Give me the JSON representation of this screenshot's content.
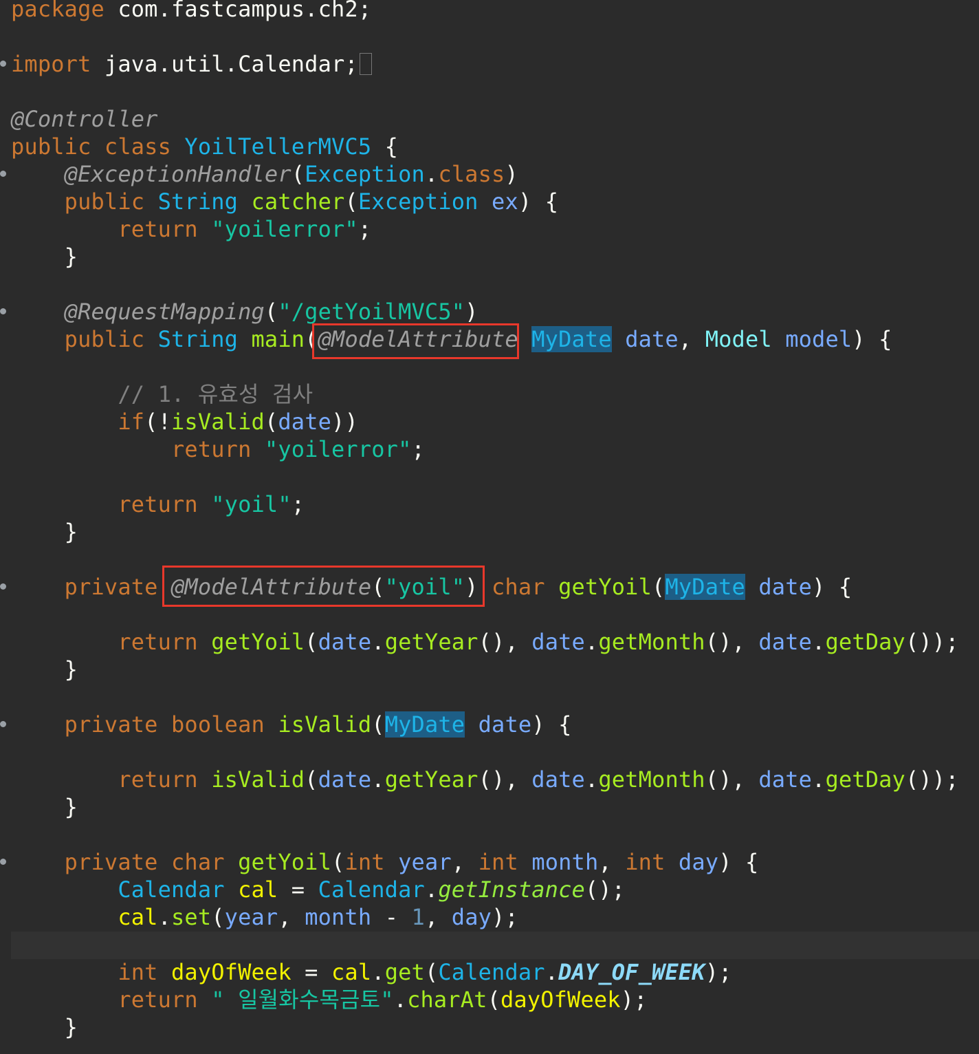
{
  "code": {
    "pkg_kw": "package",
    "pkg_name": " com.fastcampus.ch2;",
    "import_kw": "import",
    "import_name": " java.util.Calendar;",
    "ann_controller": "@Controller",
    "public": "public",
    "class": "class",
    "class_name": "YoilTellerMVC5",
    "ann_exception_handler": "@ExceptionHandler",
    "exception": "Exception",
    "string": "String",
    "catcher": "catcher",
    "ex": "ex",
    "return": "return",
    "str_yoilerror": "\"yoilerror\"",
    "ann_request_mapping": "@RequestMapping",
    "str_path": "\"/getYoilMVC5\"",
    "main": "main",
    "ann_model_attribute": "@ModelAttribute",
    "mydate": "MyDate",
    "date": "date",
    "model_type": "Model",
    "model": "model",
    "comment_validation": "// 1. 유효성 검사",
    "if": "if",
    "is_valid": "isValid",
    "str_yoil": "\"yoil\"",
    "private": "private",
    "char": "char",
    "get_yoil": "getYoil",
    "get_year": "getYear",
    "get_month": "getMonth",
    "get_day": "getDay",
    "boolean": "boolean",
    "int": "int",
    "year": "year",
    "month": "month",
    "day": "day",
    "calendar": "Calendar",
    "cal": "cal",
    "get_instance": "getInstance",
    "set": "set",
    "one": "1",
    "day_of_week": "dayOfWeek",
    "get": "get",
    "day_of_week_const": "DAY_OF_WEEK",
    "str_days": "\" 일월화수목금토\"",
    "char_at": "charAt"
  },
  "colors": {
    "background": "#2b2b2b",
    "keyword": "#cc7832",
    "annotation": "#a0a0a0",
    "type": "#1eb4e8",
    "method": "#a7ec21",
    "parameter": "#79abff",
    "local_variable": "#f2f200",
    "string": "#17c6a3",
    "highlight_box": "#e8382b"
  }
}
